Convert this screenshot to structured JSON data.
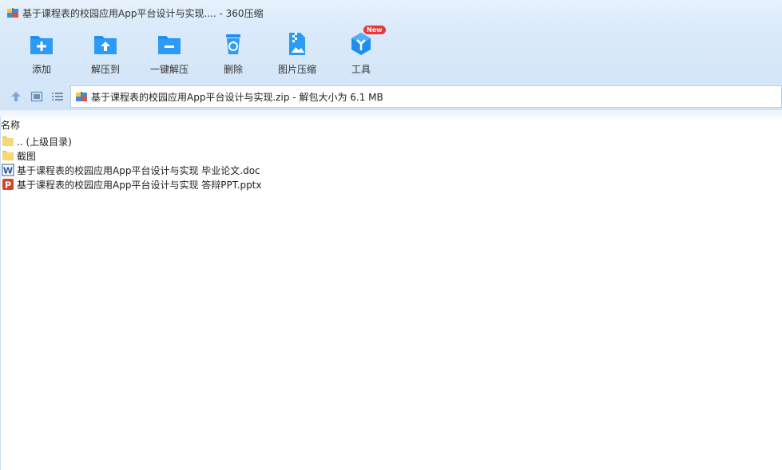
{
  "window": {
    "title": "基于课程表的校园应用App平台设计与实现.... - 360压缩",
    "icon": "archive-app-icon"
  },
  "toolbar": {
    "buttons": [
      {
        "label": "添加",
        "icon": "add-folder-icon"
      },
      {
        "label": "解压到",
        "icon": "extract-to-folder-icon"
      },
      {
        "label": "一键解压",
        "icon": "one-click-extract-icon"
      },
      {
        "label": "删除",
        "icon": "recycle-bin-icon"
      },
      {
        "label": "图片压缩",
        "icon": "image-compress-icon"
      },
      {
        "label": "工具",
        "icon": "tools-icon",
        "badge": "New"
      }
    ]
  },
  "navbar": {
    "buttons": [
      "up-arrow-icon",
      "thumbnail-view-icon",
      "list-view-icon"
    ],
    "path": "基于课程表的校园应用App平台设计与实现.zip - 解包大小为 6.1 MB"
  },
  "filelist": {
    "header": "名称",
    "rows": [
      {
        "name": ".. (上级目录)",
        "icon": "folder-icon"
      },
      {
        "name": "截图",
        "icon": "folder-icon"
      },
      {
        "name": "基于课程表的校园应用App平台设计与实现 毕业论文.doc",
        "icon": "word-doc-icon"
      },
      {
        "name": "基于课程表的校园应用App平台设计与实现 答辩PPT.pptx",
        "icon": "powerpoint-icon"
      }
    ]
  },
  "colors": {
    "accent": "#1e8ff0",
    "toolbar_bg": "#d8e8f9",
    "badge": "#e8363a",
    "folder": "#f8d775",
    "word": "#2b5797",
    "ppt": "#d24726"
  }
}
